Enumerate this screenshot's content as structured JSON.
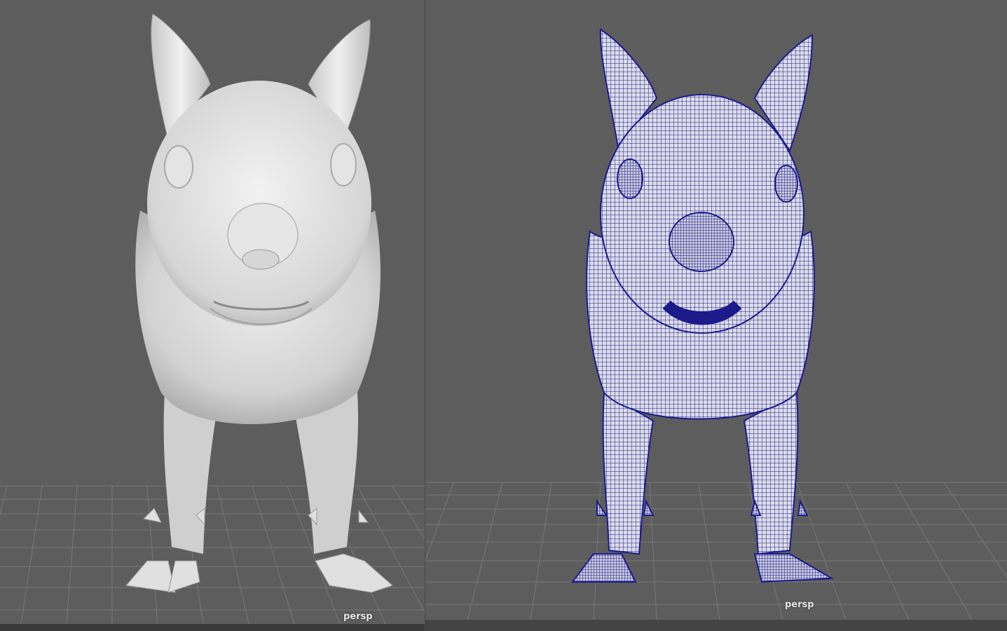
{
  "viewports": [
    {
      "id": "left",
      "camera": "persp",
      "display_mode": "smooth-shaded"
    },
    {
      "id": "right",
      "camera": "persp",
      "display_mode": "wireframe-on-shaded"
    }
  ],
  "colors": {
    "background": "#5d5d5d",
    "grid_line": "#7a7a7a",
    "model_shaded": "#d8d8d8",
    "wireframe": "#1b1b8c"
  },
  "icons": [
    "squirrel-model",
    "grid-floor"
  ]
}
